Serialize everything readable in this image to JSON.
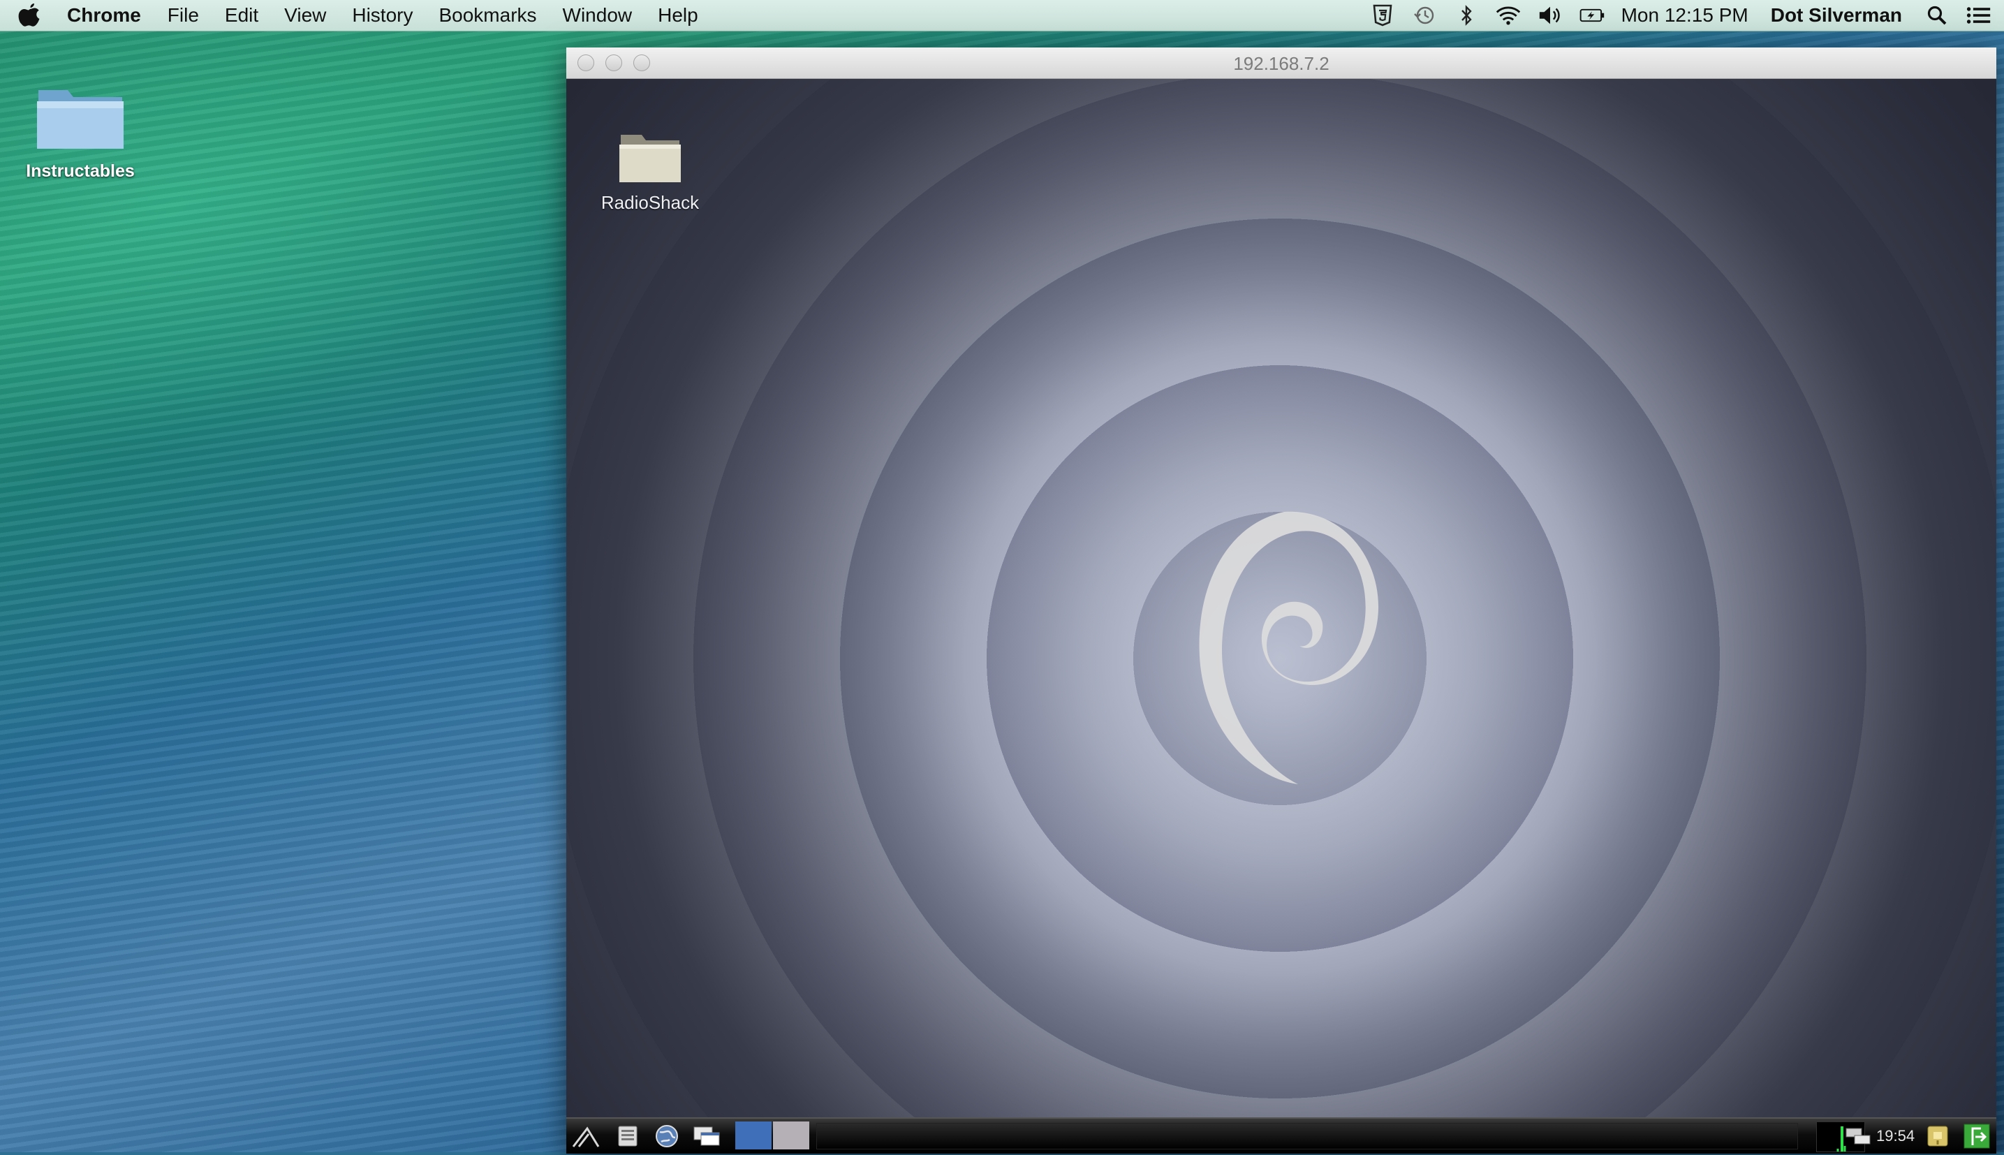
{
  "menubar": {
    "app_name": "Chrome",
    "menus": [
      "File",
      "Edit",
      "View",
      "History",
      "Bookmarks",
      "Window",
      "Help"
    ],
    "status_icons": [
      "html5-shield-icon",
      "time-machine-icon",
      "bluetooth-icon",
      "wifi-icon",
      "volume-icon",
      "battery-icon"
    ],
    "clock": "Mon 12:15 PM",
    "user": "Dot Silverman",
    "search_icon": "spotlight-search-icon",
    "list_icon": "notification-center-icon"
  },
  "desktop": {
    "folder_label": "Instructables"
  },
  "vnc_window": {
    "title": "192.168.7.2",
    "remote_desktop": {
      "folder_label": "RadioShack",
      "logo": "debian-swirl",
      "panel": {
        "clock": "19:54",
        "launchers": [
          "lxde-menu-icon",
          "file-manager-icon",
          "web-browser-icon",
          "desktop-switch-icon"
        ],
        "workspace_colors": [
          "#3f6fb8",
          "#b4b0b6"
        ],
        "tray_icons": [
          "network-icon",
          "update-notifier-icon",
          "logout-icon"
        ]
      }
    }
  }
}
